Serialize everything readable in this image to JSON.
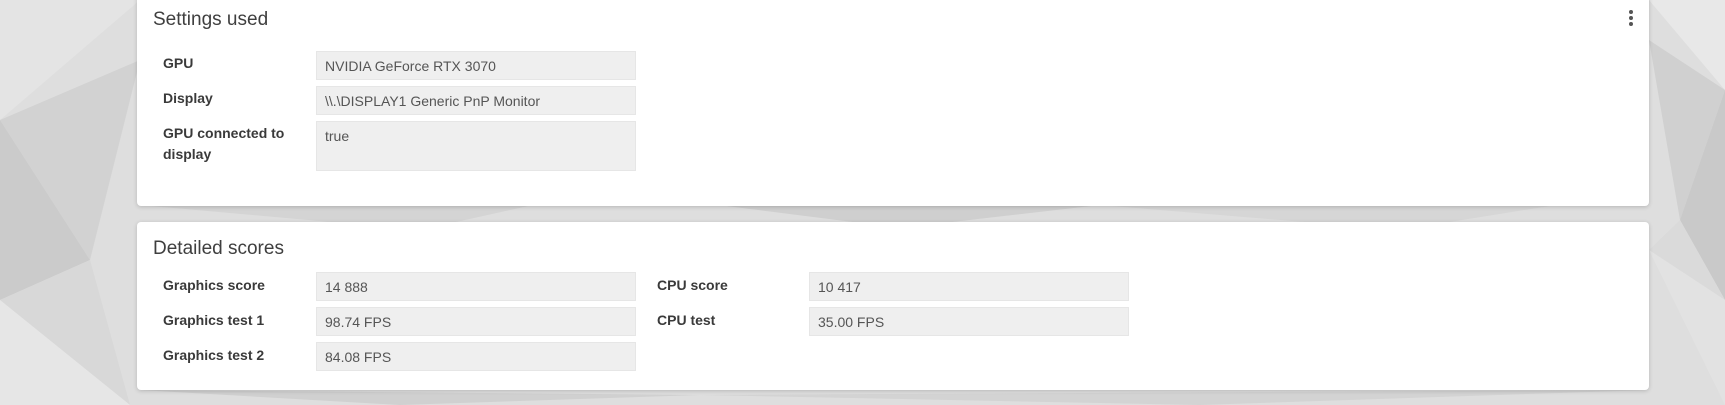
{
  "settings": {
    "title": "Settings used",
    "rows": [
      {
        "label": "GPU",
        "value": "NVIDIA GeForce RTX 3070"
      },
      {
        "label": "Display",
        "value": "\\\\.\\DISPLAY1 Generic PnP Monitor"
      },
      {
        "label": "GPU connected to display",
        "value": "true"
      }
    ],
    "menu_icon": "kebab-menu-icon"
  },
  "scores": {
    "title": "Detailed scores",
    "left": [
      {
        "label": "Graphics score",
        "value": "14 888"
      },
      {
        "label": "Graphics test 1",
        "value": "98.74 FPS"
      },
      {
        "label": "Graphics test 2",
        "value": "84.08 FPS"
      }
    ],
    "right": [
      {
        "label": "CPU score",
        "value": "10 417"
      },
      {
        "label": "CPU test",
        "value": "35.00 FPS"
      }
    ]
  },
  "colors": {
    "page_background": "#dcdcdc",
    "panel_background": "#ffffff",
    "field_background": "#efefef"
  }
}
